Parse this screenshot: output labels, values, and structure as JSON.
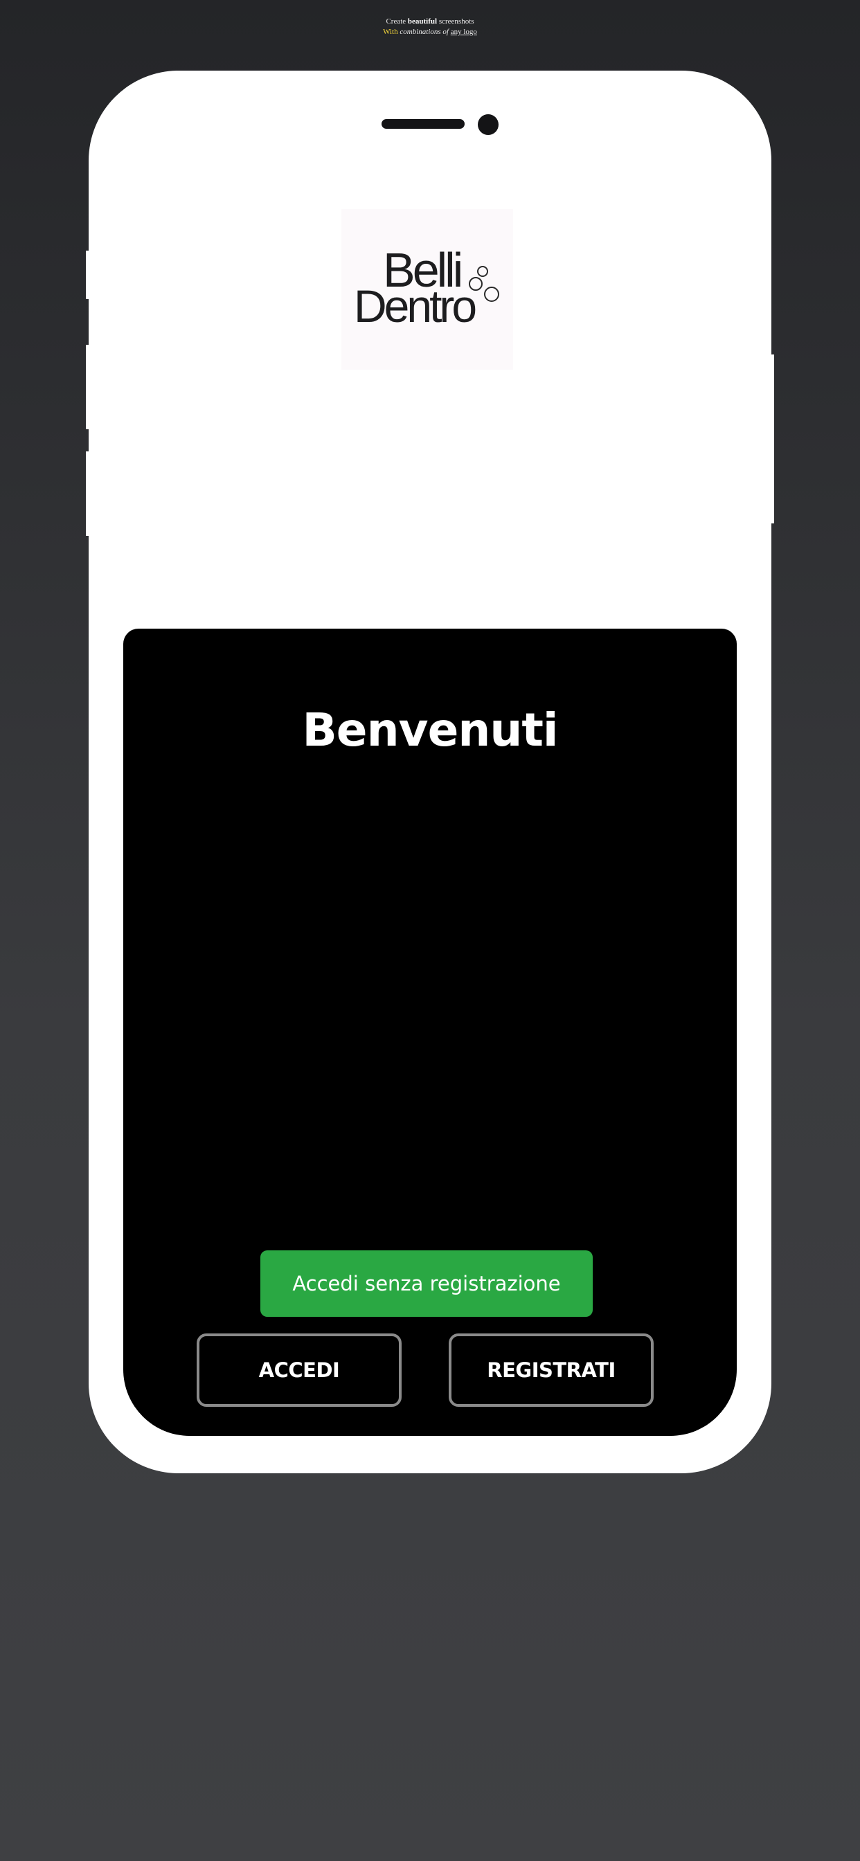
{
  "promo": {
    "line1_pre": "Create ",
    "line1_bold": "beautiful",
    "line1_post": " screenshots",
    "line2_with": "With",
    "line2_mid": " combinations of ",
    "line2_link": "any logo"
  },
  "logo": {
    "line1": "Belli",
    "line2": "Dentro"
  },
  "screen": {
    "welcome_title": "Benvenuti",
    "guest_button_label": "Accedi senza registrazione",
    "login_button_label": "ACCEDI",
    "register_button_label": "REGISTRATI"
  },
  "colors": {
    "background_top": "#242528",
    "background_bottom": "#3f4043",
    "phone_frame": "#ffffff",
    "screen_bg": "#000000",
    "guest_button": "#2aa843",
    "outline_border": "#8a8a8a"
  }
}
